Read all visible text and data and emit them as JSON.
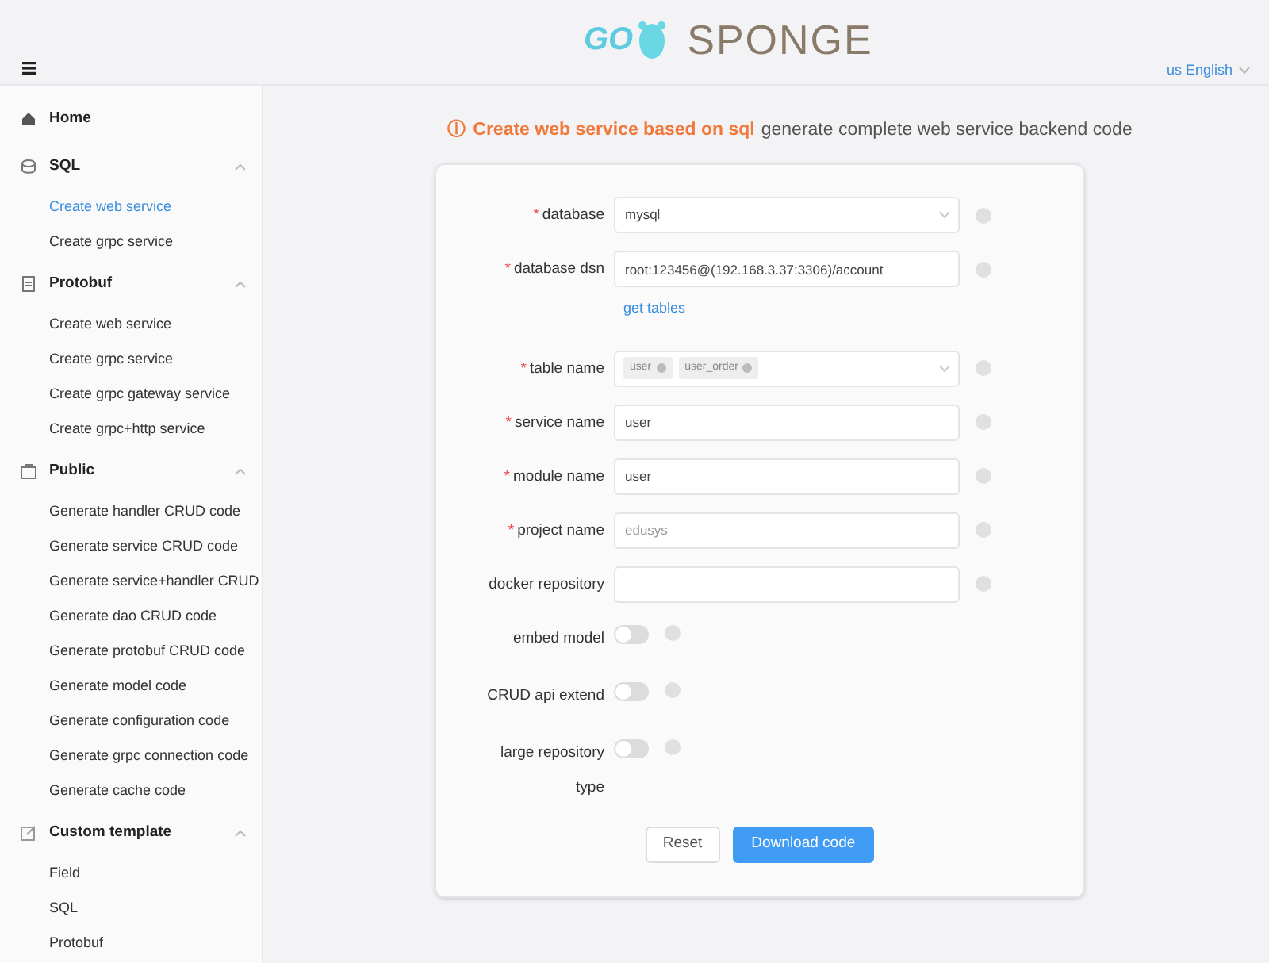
{
  "header": {
    "logo_left": "GO",
    "logo_right": "SPONGE",
    "language": "us English"
  },
  "sidebar": {
    "items": [
      {
        "kind": "link",
        "label": "Home",
        "selected": false
      },
      {
        "kind": "group",
        "label": "SQL",
        "expanded": true,
        "children": [
          {
            "label": "Create web service",
            "selected": true
          },
          {
            "label": "Create grpc service",
            "selected": false
          }
        ]
      },
      {
        "kind": "group",
        "label": "Protobuf",
        "expanded": true,
        "children": [
          {
            "label": "Create web service",
            "selected": false
          },
          {
            "label": "Create grpc service",
            "selected": false
          },
          {
            "label": "Create grpc gateway service",
            "selected": false
          },
          {
            "label": "Create grpc+http service",
            "selected": false
          }
        ]
      },
      {
        "kind": "group",
        "label": "Public",
        "expanded": true,
        "children": [
          {
            "label": "Generate handler CRUD code",
            "selected": false
          },
          {
            "label": "Generate service CRUD code",
            "selected": false
          },
          {
            "label": "Generate service+handler CRUD",
            "selected": false
          },
          {
            "label": "Generate dao CRUD code",
            "selected": false
          },
          {
            "label": "Generate protobuf CRUD code",
            "selected": false
          },
          {
            "label": "Generate model code",
            "selected": false
          },
          {
            "label": "Generate configuration code",
            "selected": false
          },
          {
            "label": "Generate grpc connection code",
            "selected": false
          },
          {
            "label": "Generate cache code",
            "selected": false
          }
        ]
      },
      {
        "kind": "group",
        "label": "Custom template",
        "expanded": true,
        "children": [
          {
            "label": "Field",
            "selected": false
          },
          {
            "label": "SQL",
            "selected": false
          },
          {
            "label": "Protobuf",
            "selected": false
          }
        ]
      }
    ]
  },
  "page": {
    "title_icon": "ⓘ",
    "title": "Create web service based on sql",
    "subtitle": "generate complete web service backend code"
  },
  "form": {
    "fields": [
      {
        "kind": "select",
        "marker": "*",
        "label": "database",
        "value": "mysql"
      },
      {
        "kind": "input",
        "marker": "*",
        "label": "database dsn",
        "value": "root:123456@(192.168.3.37:3306)/account",
        "link": "get tables"
      },
      {
        "kind": "tags",
        "marker": "*",
        "label": "table name",
        "tags": [
          "user",
          "user_order"
        ]
      },
      {
        "kind": "input",
        "marker": "*",
        "label": "service name",
        "value": "user"
      },
      {
        "kind": "input",
        "marker": "*",
        "label": "module name",
        "value": "user"
      },
      {
        "kind": "input",
        "marker": "*",
        "label": "project name",
        "placeholder": "edusys"
      },
      {
        "kind": "input",
        "label": "docker repository"
      },
      {
        "kind": "toggle",
        "label": "embed model",
        "on": false
      },
      {
        "kind": "toggle",
        "label": "CRUD api extend",
        "on": false
      },
      {
        "kind": "toggle",
        "label": "large repository type",
        "on": false
      }
    ],
    "buttons": [
      {
        "kind": "secondary",
        "label": "Reset"
      },
      {
        "kind": "primary",
        "label": "Download code"
      }
    ]
  }
}
